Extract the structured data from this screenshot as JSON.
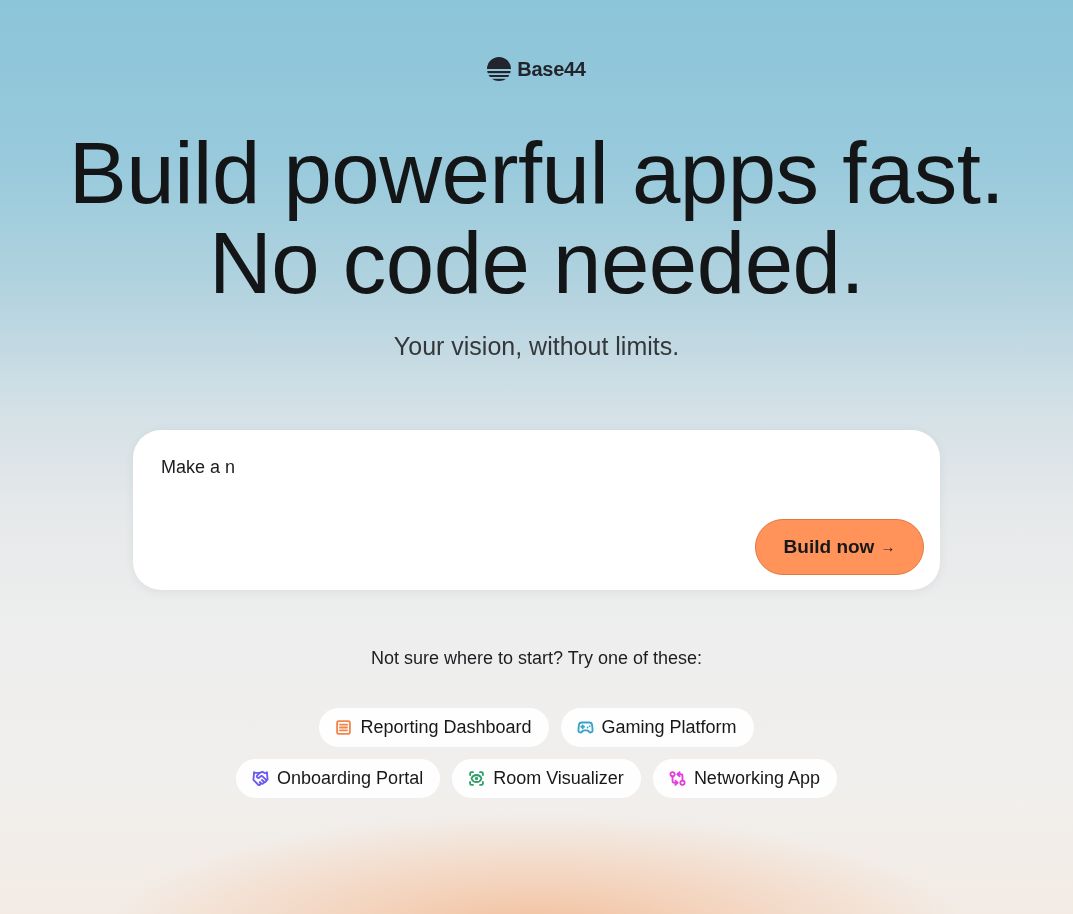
{
  "logo": {
    "text": "Base44"
  },
  "headline": [
    "Build powerful apps fast.",
    "No code needed."
  ],
  "subtitle": "Your vision, without limits.",
  "prompt": {
    "value": "Make a n",
    "button": {
      "label": "Build now",
      "arrow": "→"
    }
  },
  "suggestions_label": "Not sure where to start? Try one of these:",
  "suggestion_rows": [
    [
      {
        "label": "Reporting Dashboard",
        "kind": "report",
        "color": "#f2844a"
      },
      {
        "label": "Gaming Platform",
        "kind": "gamepad",
        "color": "#3aa3c8"
      }
    ],
    [
      {
        "label": "Onboarding Portal",
        "kind": "handshake",
        "color": "#6a5af0"
      },
      {
        "label": "Room Visualizer",
        "kind": "eye",
        "color": "#2e9d68"
      },
      {
        "label": "Networking App",
        "kind": "swap",
        "color": "#e03fd8"
      }
    ]
  ]
}
